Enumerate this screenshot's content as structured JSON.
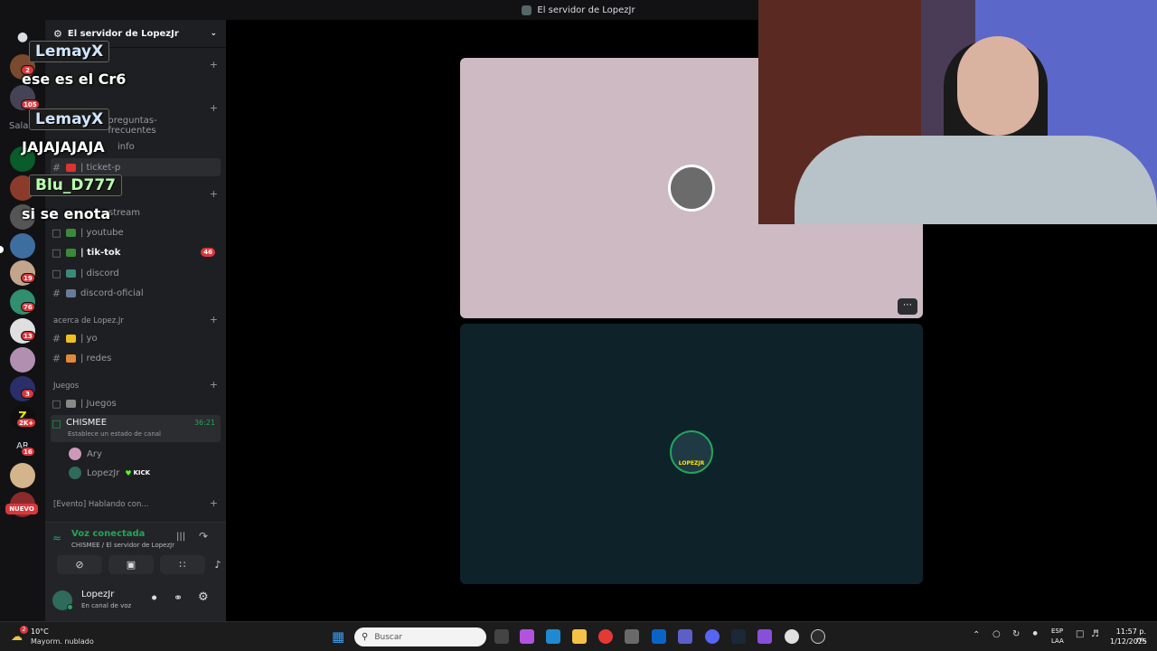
{
  "window": {
    "title": "El servidor de LopezJr"
  },
  "server": {
    "name": "El servidor de LopezJr"
  },
  "rail_badges": [
    "2",
    "105",
    "19",
    "76",
    "13",
    "3",
    "2K+",
    "16"
  ],
  "rail_label_ar": "AR",
  "rail_new": "NUEVO",
  "channels": {
    "faq": "preguntas-frecuentes",
    "info": "info",
    "ticket": "| ticket-p",
    "stream": "stream",
    "youtube": "| youtube",
    "tiktok": "| tik-tok",
    "tiktok_badge": "46",
    "discord": "| discord",
    "discord_oficial": "discord-oficial",
    "yo": "| yo",
    "redes": "| redes",
    "juegos": "| Juegos",
    "chismee": "CHISMEE",
    "chismee_time": "36:21",
    "chismee_status": "Establece un estado de canal"
  },
  "categories": {
    "salas": "Sala",
    "acerca": "acerca de Lopez.Jr",
    "juegos": "Juegos",
    "evento": "[Evento] Hablando con..."
  },
  "voice_users": [
    {
      "name": "Ary"
    },
    {
      "name": "LopezJr",
      "tag": "KICK"
    }
  ],
  "voice": {
    "status": "Voz conectada",
    "location": "CHISMEE / El servidor de LopezJr"
  },
  "user": {
    "name": "LopezJr",
    "status": "En canal de voz"
  },
  "tiles": [
    {
      "bg": "#cdbac3",
      "avatar_color": "#6b6b6b"
    },
    {
      "bg": "#0e2229",
      "avatar_color": "#1f3a44",
      "avatar_text": "LOPEZJR"
    }
  ],
  "overlay_chat": [
    {
      "user": "LemayX",
      "message": "ese es el Cr6",
      "color": "#cfe6ff"
    },
    {
      "user": "LemayX",
      "message": "JAJAJAJAJA",
      "color": "#cfe6ff"
    },
    {
      "user": "Blu_D777",
      "message": "si se enota",
      "color": "#b8ffb0"
    }
  ],
  "taskbar": {
    "weather_temp": "10°C",
    "weather_desc": "Mayorm. nublado",
    "weather_badge": "2",
    "search_placeholder": "Buscar",
    "lang": "ESP",
    "lang2": "LAA",
    "time": "11:57 p. m.",
    "date": "1/12/2025"
  }
}
